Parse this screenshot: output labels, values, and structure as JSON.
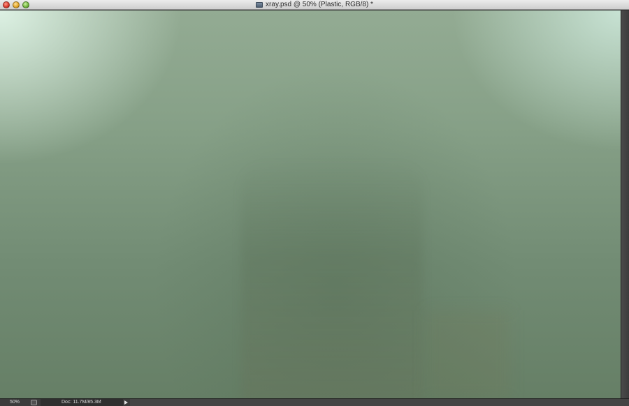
{
  "window": {
    "title": "xray.psd @ 50% (Plastic, RGB/8) *"
  },
  "icons": {
    "close": "close-icon",
    "minimize": "minimize-icon",
    "zoom": "zoom-icon",
    "document": "psd-document-icon",
    "status": "status-menu-icon",
    "arrow": "play-arrow-icon"
  },
  "status_bar": {
    "zoom_level": "50%",
    "doc_info": "Doc: 11.7M/85.3M"
  },
  "colors": {
    "canvas_top": "#93ab93",
    "canvas_bottom": "#667f66",
    "canvas_highlight": "#e1f5e8"
  }
}
